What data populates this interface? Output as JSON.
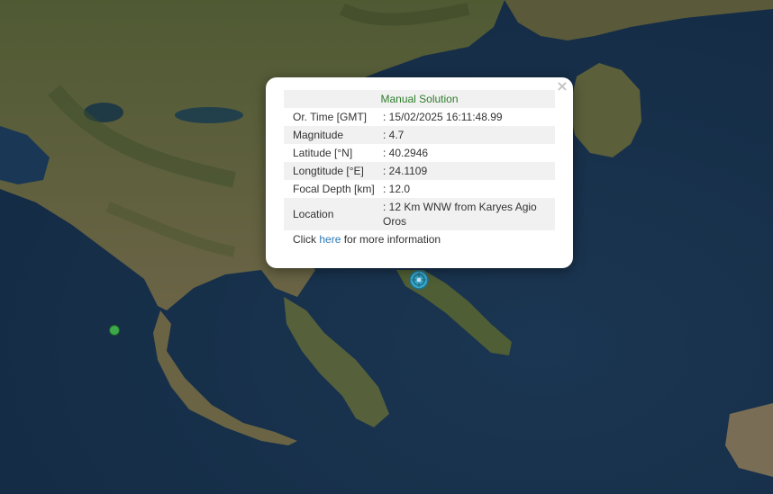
{
  "popup": {
    "title": "Manual Solution",
    "close_symbol": "×",
    "rows": [
      {
        "label": "Or. Time [GMT]",
        "value": ": 15/02/2025 16:11:48.99"
      },
      {
        "label": "Magnitude",
        "value": ": 4.7"
      },
      {
        "label": "Latitude [°N]",
        "value": ": 40.2946"
      },
      {
        "label": "Longtitude [°E]",
        "value": ": 24.1109"
      },
      {
        "label": "Focal Depth [km]",
        "value": ": 12.0"
      },
      {
        "label": "Location",
        "value": ": 12 Km WNW from Karyes Agio Oros"
      }
    ],
    "more_prefix": "Click ",
    "more_link": "here",
    "more_suffix": " for more information"
  },
  "map": {
    "style": "satellite",
    "sea_color": "#162f4a",
    "land_color": "#5b5a3c",
    "event_marker_icon": "earthquake-epicenter-icon",
    "event_marker_color": "#3aa7c9",
    "secondary_event_color": "#3caa4a"
  }
}
